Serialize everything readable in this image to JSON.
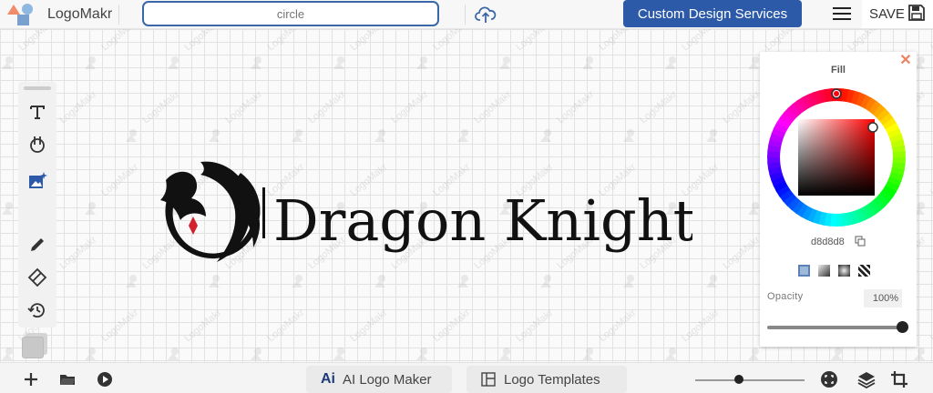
{
  "topbar": {
    "brand": "LogoMakr",
    "search_value": "",
    "search_placeholder": "circle",
    "cta_label": "Custom Design Services",
    "save_label": "SAVE"
  },
  "canvas": {
    "watermark_text": "LogoMakr",
    "logo_text": "Dragon Knight",
    "logo_text_color": "#111111",
    "emblem_color": "#111111",
    "emblem_accent": "#d41f2f"
  },
  "toolbar": {
    "tools": [
      "text-tool",
      "shape-tool",
      "image-tool",
      "draw-tool",
      "erase-tool",
      "history-tool"
    ]
  },
  "fill_panel": {
    "title": "Fill",
    "hex": "d8d8d8",
    "fill_types": [
      "solid",
      "linear-gradient",
      "radial-gradient",
      "pattern"
    ],
    "opacity_label": "Opacity",
    "opacity_value": "100%",
    "opacity": 1.0
  },
  "bottombar": {
    "ai_label": "AI Logo Maker",
    "ai_icon_text": "Ai",
    "templates_label": "Logo Templates"
  },
  "colors": {
    "accent": "#2c5aa9",
    "close": "#f08060"
  }
}
